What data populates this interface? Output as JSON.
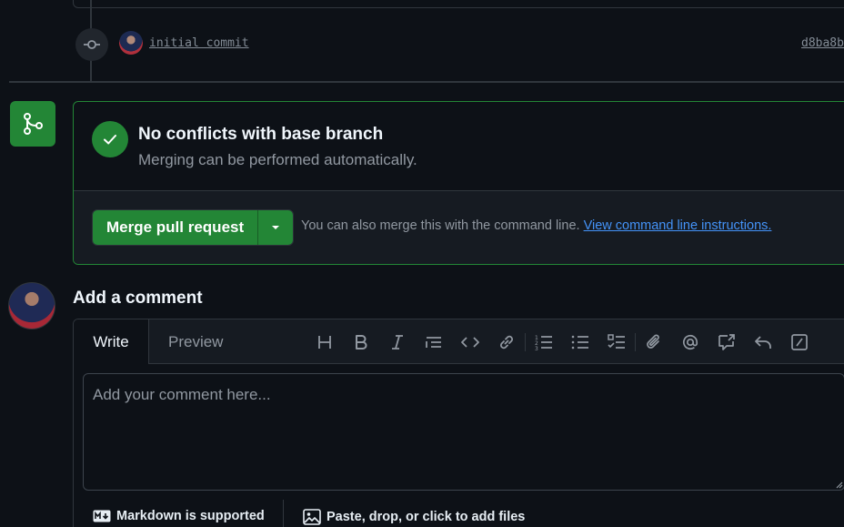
{
  "timeline": {
    "commit_message": "initial commit",
    "commit_sha": "d8ba8b"
  },
  "merge": {
    "title": "No conflicts with base branch",
    "subtitle": "Merging can be performed automatically.",
    "button_label": "Merge pull request",
    "hint_text": "You can also merge this with the command line.",
    "hint_link": "View command line instructions.",
    "accent_color": "#238636"
  },
  "comment": {
    "heading": "Add a comment",
    "tabs": {
      "write": "Write",
      "preview": "Preview"
    },
    "placeholder": "Add your comment here...",
    "toolbar_icons": [
      "heading-icon",
      "bold-icon",
      "italic-icon",
      "quote-icon",
      "code-icon",
      "link-icon",
      "numbered-list-icon",
      "unordered-list-icon",
      "task-list-icon",
      "attach-icon",
      "mention-icon",
      "reference-icon",
      "reply-icon",
      "slash-command-icon"
    ],
    "markdown_label": "Markdown is supported",
    "attach_label": "Paste, drop, or click to add files"
  },
  "colors": {
    "background": "#0d1117",
    "border": "#30363d",
    "link": "#4493f8",
    "muted": "#9198a1"
  }
}
